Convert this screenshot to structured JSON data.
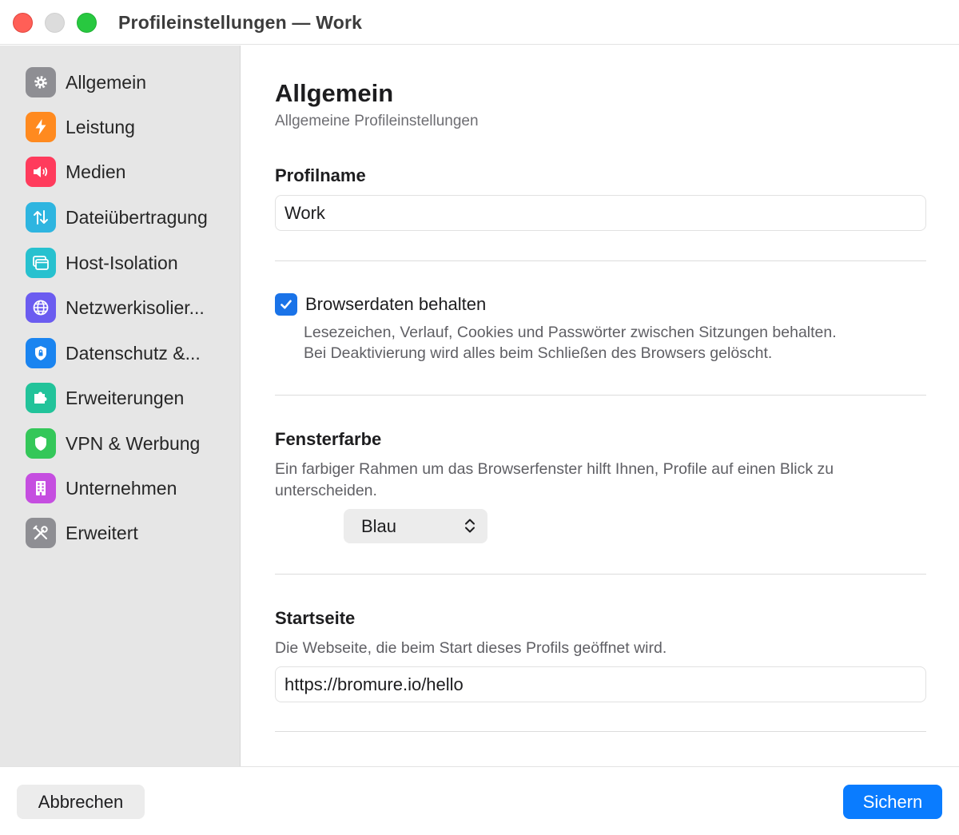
{
  "window": {
    "title": "Profileinstellungen — Work"
  },
  "sidebar": {
    "items": [
      {
        "label": "Allgemein",
        "icon": "gear-icon",
        "color": "#8e8e93"
      },
      {
        "label": "Leistung",
        "icon": "bolt-icon",
        "color": "#ff8a1f"
      },
      {
        "label": "Medien",
        "icon": "speaker-icon",
        "color": "#ff3b5c"
      },
      {
        "label": "Dateiübertragung",
        "icon": "transfer-arrows-icon",
        "color": "#2eb5e0"
      },
      {
        "label": "Host-Isolation",
        "icon": "window-stack-icon",
        "color": "#27c1cf"
      },
      {
        "label": "Netzwerkisolier...",
        "icon": "globe-icon",
        "color": "#6b5cf0"
      },
      {
        "label": "Datenschutz &...",
        "icon": "lock-shield-icon",
        "color": "#1a84f0"
      },
      {
        "label": "Erweiterungen",
        "icon": "puzzle-icon",
        "color": "#22c39a"
      },
      {
        "label": "VPN & Werbung",
        "icon": "shield-icon",
        "color": "#34c759"
      },
      {
        "label": "Unternehmen",
        "icon": "building-icon",
        "color": "#c54ee0"
      },
      {
        "label": "Erweitert",
        "icon": "tools-icon",
        "color": "#8e8e93"
      }
    ]
  },
  "main": {
    "title": "Allgemein",
    "subtitle": "Allgemeine Profileinstellungen",
    "profile_name": {
      "label": "Profilname",
      "value": "Work"
    },
    "browser_data": {
      "label": "Browserdaten behalten",
      "checked": true,
      "help_line1": "Lesezeichen, Verlauf, Cookies und Passwörter zwischen Sitzungen behalten.",
      "help_line2": "Bei Deaktivierung wird alles beim Schließen des Browsers gelöscht."
    },
    "window_color": {
      "label": "Fensterfarbe",
      "help": "Ein farbiger Rahmen um das Browserfenster hilft Ihnen, Profile auf einen Blick zu unterscheiden.",
      "selected": "Blau"
    },
    "start_page": {
      "label": "Startseite",
      "help": "Die Webseite, die beim Start dieses Profils geöffnet wird.",
      "value": "https://bromure.io/hello"
    }
  },
  "footer": {
    "cancel_label": "Abbrechen",
    "save_label": "Sichern"
  },
  "colors": {
    "accent": "#0a7cff",
    "checkbox": "#1a73e8"
  }
}
